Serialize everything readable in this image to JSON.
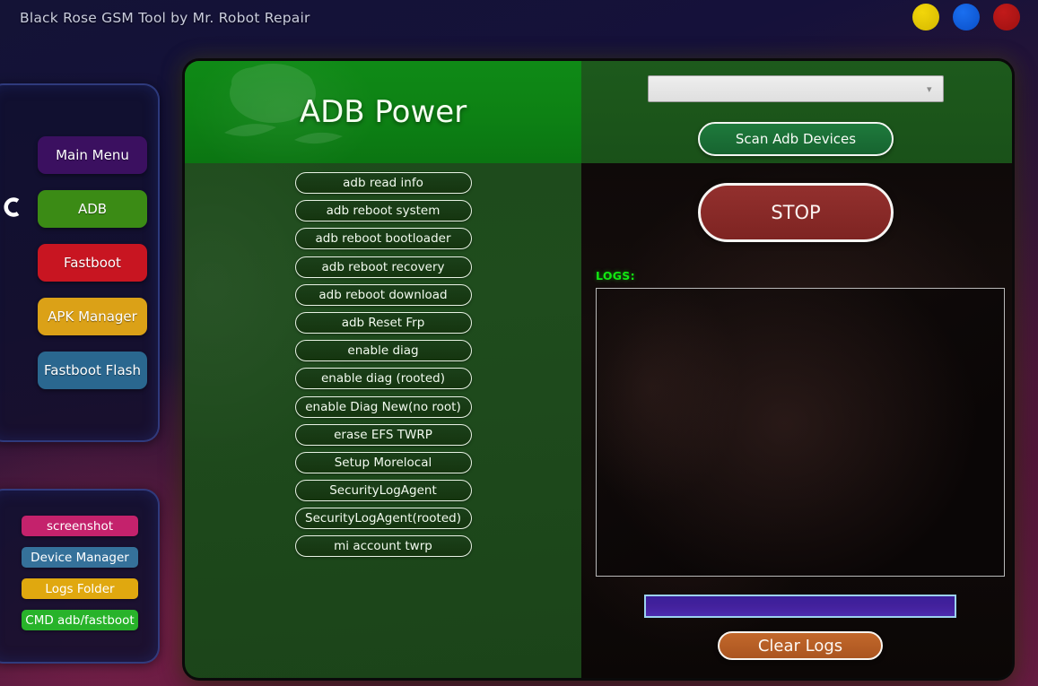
{
  "window": {
    "title": "Black Rose GSM Tool by Mr. Robot Repair",
    "controls": [
      {
        "name": "minimize-button",
        "color": "#f2d60a"
      },
      {
        "name": "maximize-button",
        "color": "#1a6ff0"
      },
      {
        "name": "close-button",
        "color": "#c21a1a"
      }
    ]
  },
  "sidebar": {
    "refresh_icon": "refresh-arc-icon",
    "nav_items": [
      {
        "label": "Main Menu",
        "color": "#3b1060"
      },
      {
        "label": "ADB",
        "color": "#3b8b15"
      },
      {
        "label": "Fastboot",
        "color": "#c81521"
      },
      {
        "label": "APK Manager",
        "color": "#dba117"
      },
      {
        "label": "Fastboot Flash",
        "color": "#2a678f"
      }
    ],
    "util_items": [
      {
        "label": "screenshot",
        "color": "#c4226c"
      },
      {
        "label": "Device Manager",
        "color": "#35719a"
      },
      {
        "label": "Logs Folder",
        "color": "#e0a80f"
      },
      {
        "label": "CMD adb/fastboot",
        "color": "#28b32a"
      }
    ]
  },
  "main": {
    "panel_title": "ADB Power",
    "actions": [
      "adb read info",
      "adb reboot system",
      "adb reboot bootloader",
      "adb reboot recovery",
      "adb reboot download",
      "adb Reset Frp",
      "enable diag",
      "enable diag (rooted)",
      "enable Diag New(no root)",
      "erase EFS TWRP",
      "Setup Morelocal",
      "SecurityLogAgent",
      "SecurityLogAgent(rooted)",
      "mi account twrp"
    ]
  },
  "right": {
    "device_select": {
      "value": "",
      "placeholder": "",
      "chevron_icon": "chevron-down-icon"
    },
    "scan_label": "Scan Adb Devices",
    "stop_label": "STOP",
    "logs_label": "LOGS:",
    "logs_value": "",
    "progress_percent": 100,
    "clear_label": "Clear Logs"
  },
  "colors": {
    "header_green": "#0d8114",
    "body_green": "#1f4c1d",
    "stop_red": "#8e2b2b",
    "scan_green": "#1e7a3c",
    "clear_orange": "#b95e26",
    "logs_green": "#12e812",
    "progress_purple": "#43219c",
    "progress_border": "#9cd2ef"
  }
}
